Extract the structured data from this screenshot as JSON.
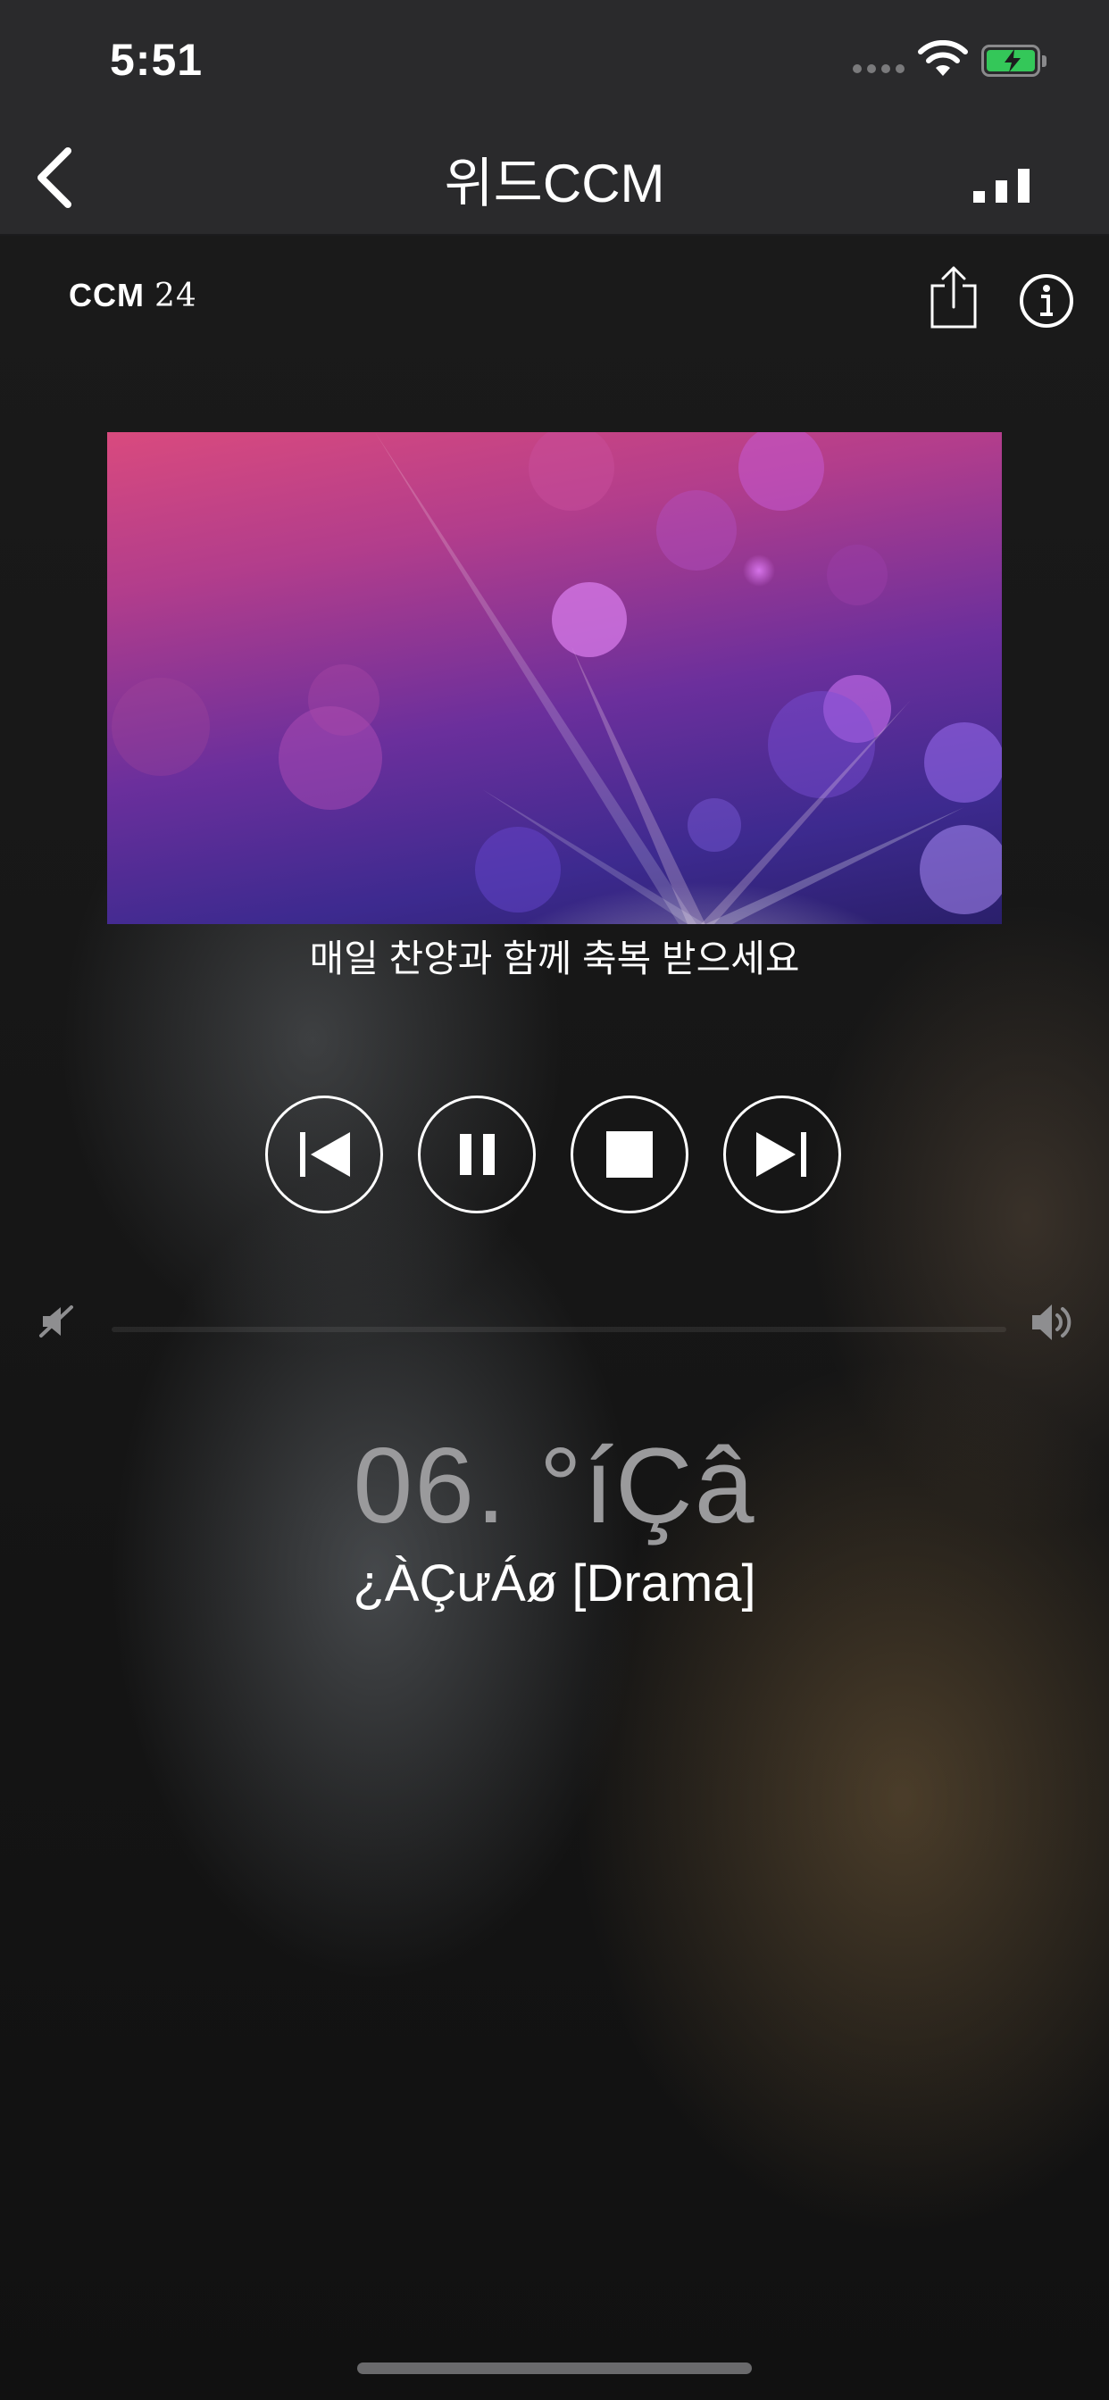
{
  "status_bar": {
    "time": "5:51"
  },
  "nav": {
    "title": "위드CCM"
  },
  "header": {
    "logo_text": "CCM",
    "logo_number": "24"
  },
  "artwork": {
    "caption": "매일 찬양과 함께 축복 받으세요"
  },
  "controls": [
    "previous",
    "pause",
    "stop",
    "next"
  ],
  "volume": {
    "level": 0
  },
  "now_playing": {
    "title": "06. °íÇâ",
    "artist": "¿ÀÇưÁø [Drama]"
  },
  "colors": {
    "battery": "#34c759",
    "title_gray": "#9a9a9c"
  }
}
